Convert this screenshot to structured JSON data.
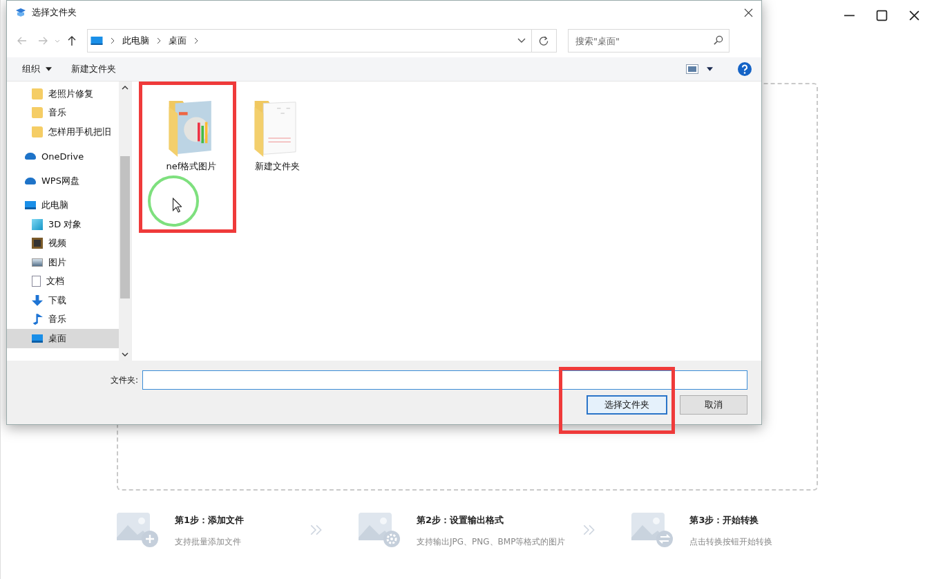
{
  "dialog": {
    "title": "选择文件夹",
    "breadcrumbs": [
      "此电脑",
      "桌面"
    ],
    "search": {
      "placeholder": "搜索\"桌面\""
    },
    "toolbar": [
      "组织",
      "新建文件夹"
    ],
    "nav": [
      {
        "children": [
          {
            "label": "老照片修复",
            "kind": "folder",
            "selected": false
          },
          {
            "label": "音乐",
            "kind": "folder",
            "selected": false
          },
          {
            "label": "怎样用手机把旧",
            "kind": "folder",
            "selected": false
          }
        ]
      },
      {
        "label": "OneDrive",
        "kind": "cloud",
        "selected": false
      },
      {
        "label": "WPS网盘",
        "kind": "cloud",
        "selected": false
      },
      {
        "label": "此电脑",
        "kind": "pc",
        "selected": false,
        "children": [
          {
            "label": "3D 对象",
            "kind": "cube",
            "selected": false
          },
          {
            "label": "视频",
            "kind": "video",
            "selected": false
          },
          {
            "label": "图片",
            "kind": "picture",
            "selected": false
          },
          {
            "label": "文档",
            "kind": "doc",
            "selected": false
          },
          {
            "label": "下载",
            "kind": "download",
            "selected": false
          },
          {
            "label": "音乐",
            "kind": "music",
            "selected": false
          },
          {
            "label": "桌面",
            "kind": "pc",
            "selected": true
          }
        ]
      }
    ],
    "items": [
      {
        "name": "nef格式图片",
        "kind": "photos"
      },
      {
        "name": "新建文件夹",
        "kind": "docs"
      }
    ],
    "folder_label": "文件夹:",
    "buttons": [
      {
        "label": "选择文件夹",
        "default": true
      },
      {
        "label": "取消",
        "default": false
      }
    ]
  },
  "steps": [
    {
      "title": "第1步：添加文件",
      "subtitle": "支持批量添加文件",
      "kind": "plus"
    },
    {
      "title": "第2步：设置输出格式",
      "subtitle": "支持输出JPG、PNG、BMP等格式的图片",
      "kind": "gear"
    },
    {
      "title": "第3步：开始转换",
      "subtitle": "点击转换按钮开始转换",
      "kind": "swap"
    }
  ]
}
